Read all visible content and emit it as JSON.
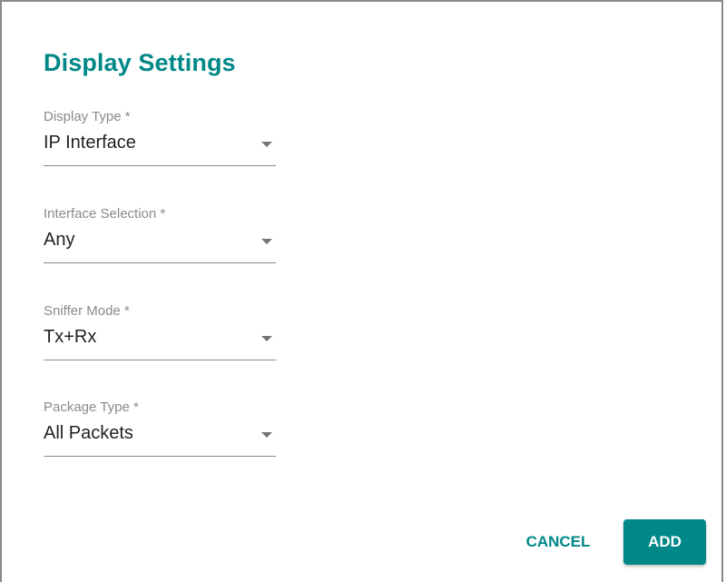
{
  "dialog": {
    "title": "Display Settings"
  },
  "fields": [
    {
      "label": "Display Type *",
      "value": "IP Interface"
    },
    {
      "label": "Interface Selection *",
      "value": "Any"
    },
    {
      "label": "Sniffer Mode *",
      "value": "Tx+Rx"
    },
    {
      "label": "Package Type *",
      "value": "All Packets"
    }
  ],
  "actions": {
    "cancel_label": "CANCEL",
    "add_label": "ADD"
  },
  "colors": {
    "accent": "#008787",
    "label_gray": "#8a8a8a",
    "text": "#212121"
  },
  "icons": {
    "dropdown": "triangle-down-icon"
  }
}
